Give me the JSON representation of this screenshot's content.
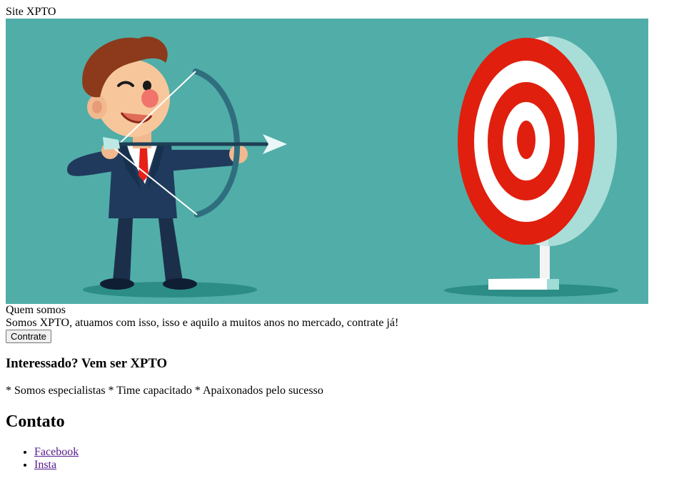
{
  "header": {
    "site_title": "Site XPTO"
  },
  "hero": {
    "image_name": "archer-businessman-target-illustration"
  },
  "about": {
    "heading": "Quem somos",
    "text": "Somos XPTO, atuamos com isso, isso e aquilo a muitos anos no mercado, contrate já!",
    "button_label": "Contrate"
  },
  "join": {
    "heading": "Interessado? Vem ser XPTO",
    "features": "* Somos especialistas * Time capacitado * Apaixonados pelo sucesso"
  },
  "contact": {
    "heading": "Contato",
    "links": [
      {
        "label": "Facebook"
      },
      {
        "label": "Insta"
      }
    ]
  },
  "colors": {
    "hero_background": "#51ada8",
    "target_red": "#e01f0e",
    "suit_navy": "#1f3a5c",
    "visited_link": "#551a8b"
  }
}
